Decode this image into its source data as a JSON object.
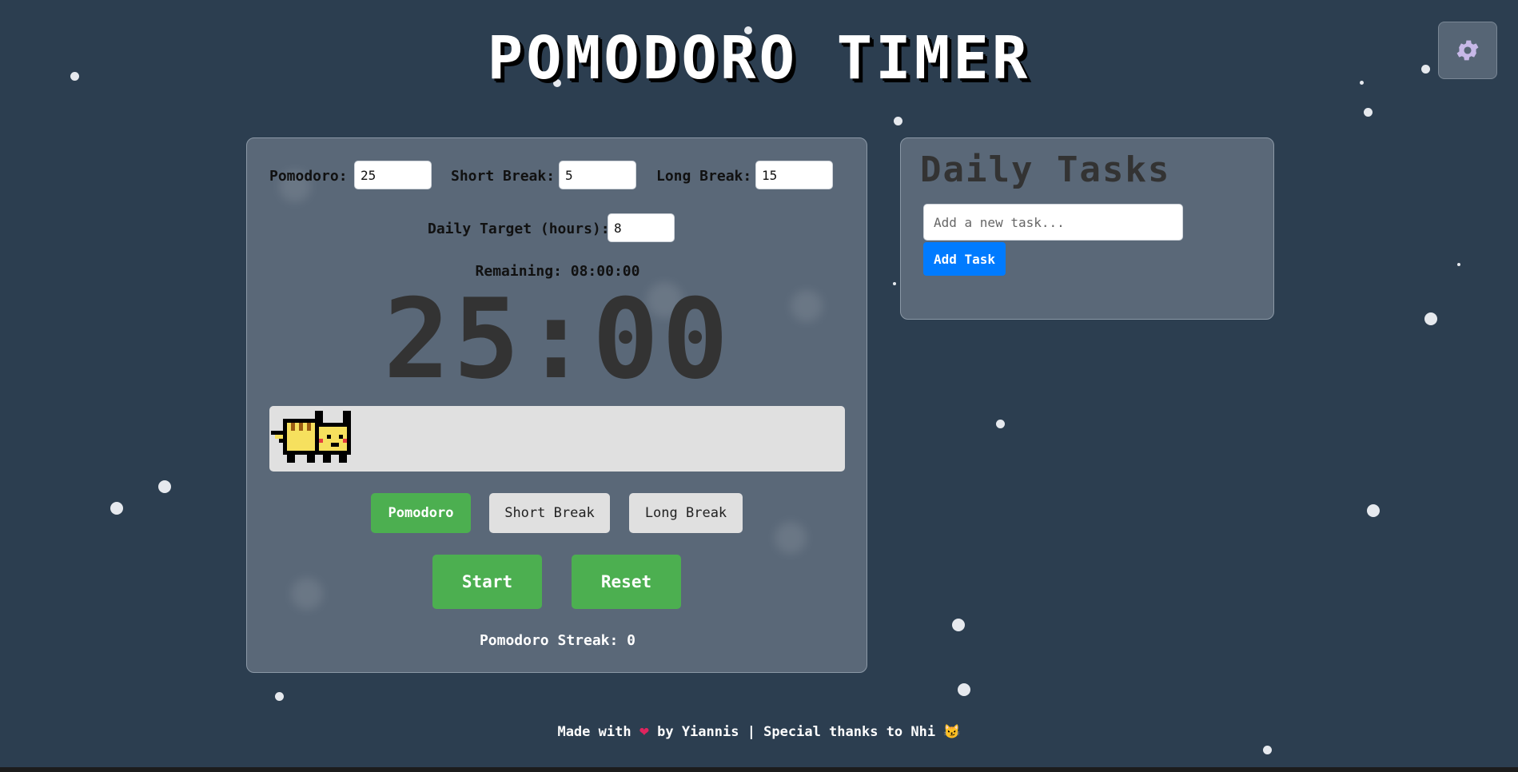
{
  "app_title": "POMODORO TIMER",
  "settings": {
    "icon": "gear-icon"
  },
  "durations": {
    "pomodoro_label": "Pomodoro:",
    "pomodoro_value": "25",
    "short_break_label": "Short Break:",
    "short_break_value": "5",
    "long_break_label": "Long Break:",
    "long_break_value": "15"
  },
  "daily_target": {
    "label": "Daily Target (hours):",
    "value": "8",
    "remaining_text": "Remaining: 08:00:00"
  },
  "timer": {
    "display": "25:00",
    "progress": 0
  },
  "modes": [
    {
      "label": "Pomodoro",
      "active": true
    },
    {
      "label": "Short Break",
      "active": false
    },
    {
      "label": "Long Break",
      "active": false
    }
  ],
  "actions": {
    "start_label": "Start",
    "reset_label": "Reset"
  },
  "streak_text": "Pomodoro Streak: 0",
  "tasks": {
    "title": "Daily Tasks",
    "input_placeholder": "Add a new task...",
    "add_label": "Add Task"
  },
  "footer": {
    "made_with": "Made with",
    "heart": "❤",
    "by_text": "by Yiannis | Special thanks to Nhi",
    "emoji": "😼"
  },
  "colors": {
    "background": "#2c3e50",
    "panel": "#5a6878",
    "accent_green": "#4caf50",
    "accent_blue": "#007bff",
    "heart": "#e0245e"
  }
}
